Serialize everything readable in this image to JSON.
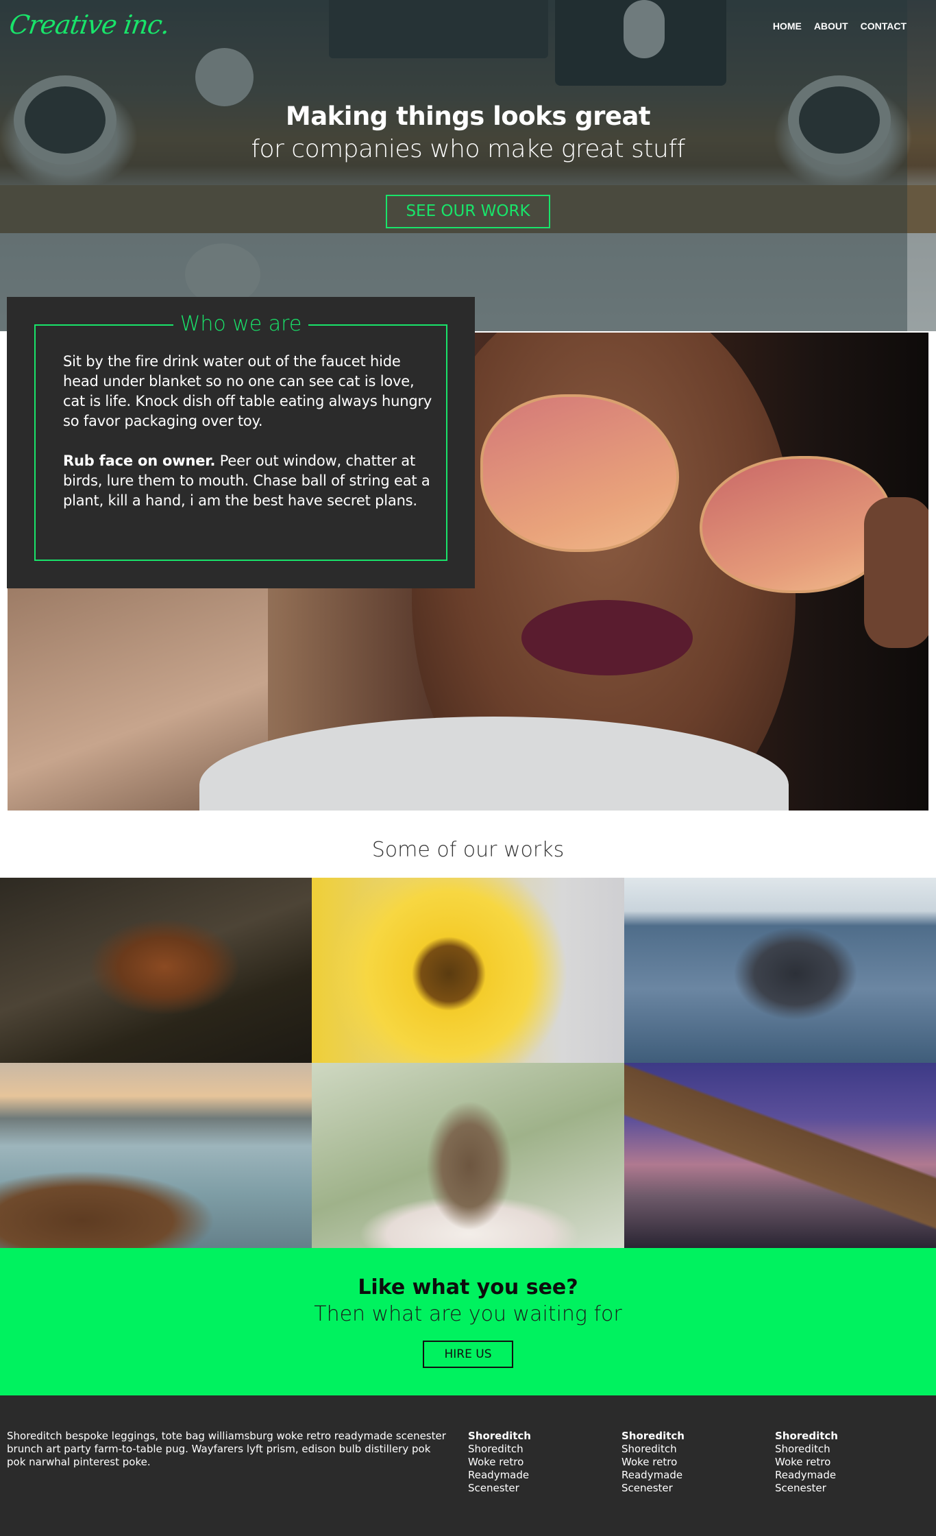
{
  "brand": {
    "logo_text": "Creative inc."
  },
  "nav": {
    "items": [
      "HOME",
      "ABOUT",
      "CONTACT"
    ]
  },
  "hero": {
    "title": "Making things looks great",
    "subtitle": "for companies who make great stuff",
    "button": "SEE OUR WORK"
  },
  "who": {
    "title": "Who we are",
    "paragraph1": "Sit by the fire drink water out of the faucet hide head under blanket so no one can see cat is love, cat is life. Knock dish off table eating always hungry so favor packaging over toy.",
    "paragraph2_bold": "Rub face on owner.",
    "paragraph2_rest": " Peer out window, chatter at birds, lure them to mouth. Chase ball of string eat a plant, kill a hand, i am the best have secret plans."
  },
  "works": {
    "title": "Some of our works",
    "tiles": [
      "fox",
      "sunflower",
      "whale",
      "beach",
      "owl",
      "bridge"
    ]
  },
  "cta": {
    "title": "Like what you see?",
    "subtitle": "Then what are you waiting for",
    "button": "HIRE US"
  },
  "footer": {
    "about": "Shoreditch bespoke leggings, tote bag williamsburg woke retro readymade scenester brunch art party farm-to-table pug. Wayfarers lyft prism, edison bulb distillery pok pok narwhal pinterest poke.",
    "columns": [
      {
        "heading": "Shoreditch",
        "links": [
          "Shoreditch",
          "Woke retro",
          "Readymade",
          "Scenester"
        ]
      },
      {
        "heading": "Shoreditch",
        "links": [
          "Shoreditch",
          "Woke retro",
          "Readymade",
          "Scenester"
        ]
      },
      {
        "heading": "Shoreditch",
        "links": [
          "Shoreditch",
          "Woke retro",
          "Readymade",
          "Scenester"
        ]
      }
    ]
  },
  "colors": {
    "accent": "#19e46a",
    "cta_bg": "#00f25f",
    "dark": "#2b2b2b"
  }
}
